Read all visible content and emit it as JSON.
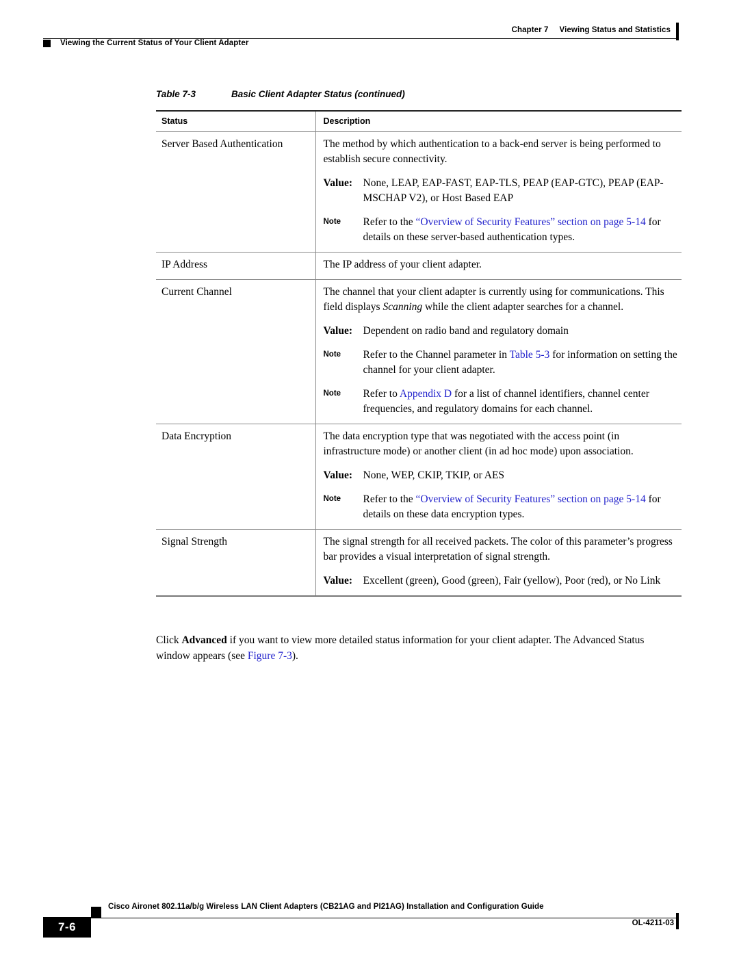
{
  "header": {
    "chapter_number": "Chapter 7",
    "chapter_title": "Viewing Status and Statistics",
    "running_head": "Viewing the Current Status of Your Client Adapter"
  },
  "table": {
    "caption_number": "Table 7-3",
    "caption_title": "Basic Client Adapter Status (continued)",
    "columns": [
      "Status",
      "Description"
    ],
    "rows": [
      {
        "status": "Server Based Authentication",
        "description": "The method by which authentication to a back-end server is being performed to establish secure connectivity.",
        "value_label": "Value:",
        "value_text": "None, LEAP, EAP-FAST, EAP-TLS, PEAP (EAP-GTC), PEAP (EAP-MSCHAP V2), or Host Based EAP",
        "notes": [
          {
            "label": "Note",
            "text_before": "Refer to the ",
            "link1": "“Overview of Security Features” section on page 5-14",
            "text_after": " for details on these server-based authentication types."
          }
        ]
      },
      {
        "status": "IP Address",
        "description": "The IP address of your client adapter."
      },
      {
        "status": "Current Channel",
        "description_part1": "The channel that your client adapter is currently using for communications. This field displays ",
        "description_italic": "Scanning",
        "description_part2": " while the client adapter searches for a channel.",
        "value_label": "Value:",
        "value_text": "Dependent on radio band and regulatory domain",
        "notes": [
          {
            "label": "Note",
            "text_before": "Refer to the Channel parameter in ",
            "link1": "Table 5-3",
            "text_after": " for information on setting the channel for your client adapter."
          },
          {
            "label": "Note",
            "text_before": "Refer to ",
            "link1": "Appendix D",
            "text_after": " for a list of channel identifiers, channel center frequencies, and regulatory domains for each channel."
          }
        ]
      },
      {
        "status": "Data Encryption",
        "description": "The data encryption type that was negotiated with the access point (in infrastructure mode) or another client (in ad hoc mode) upon association.",
        "value_label": "Value:",
        "value_text": "None, WEP, CKIP, TKIP, or AES",
        "notes": [
          {
            "label": "Note",
            "text_before": "Refer to the ",
            "link1": "“Overview of Security Features” section on page 5-14",
            "text_after": " for details on these data encryption types."
          }
        ]
      },
      {
        "status": "Signal Strength",
        "description": "The signal strength for all received packets. The color of this parameter’s progress bar provides a visual interpretation of signal strength.",
        "value_label": "Value:",
        "value_text": "Excellent (green), Good (green), Fair (yellow), Poor (red), or No Link"
      }
    ]
  },
  "body_paragraph": {
    "part1": "Click ",
    "bold1": "Advanced",
    "part2": " if you want to view more detailed status information for your client adapter. The Advanced Status window appears (see ",
    "link1": "Figure 7-3",
    "part3": ")."
  },
  "footer": {
    "page_number": "7-6",
    "guide_title": "Cisco Aironet 802.11a/b/g Wireless LAN Client Adapters (CB21AG and PI21AG) Installation and Configuration Guide",
    "doc_id": "OL-4211-03"
  },
  "colors": {
    "link": "#2222cc",
    "rule": "#000000",
    "table_rule": "#888888"
  }
}
